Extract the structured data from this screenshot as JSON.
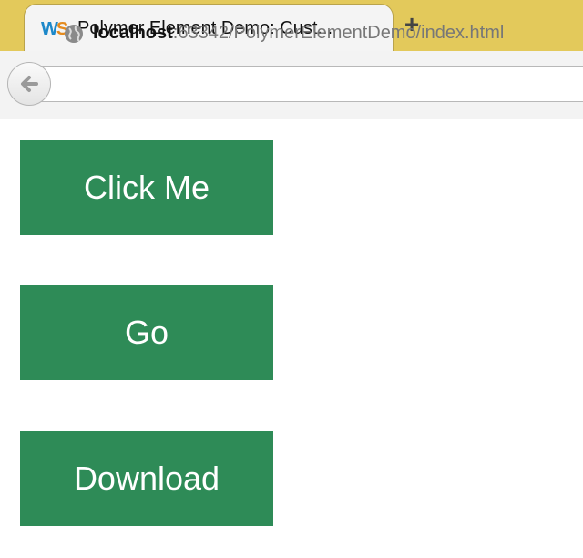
{
  "browser": {
    "tab": {
      "title": "Polymer Element Demo: Cust...",
      "favicon": "webstorm-ws-icon"
    },
    "new_tab_label": "+",
    "url": {
      "host": "localhost",
      "rest": ":63342/PolymerElementDemo/index.html"
    },
    "colors": {
      "tabstrip": "#e3c95b"
    }
  },
  "page": {
    "buttons": [
      {
        "label": "Click Me"
      },
      {
        "label": "Go"
      },
      {
        "label": "Download"
      }
    ],
    "colors": {
      "button_bg": "#2e8b57",
      "button_text": "#ffffff"
    }
  }
}
